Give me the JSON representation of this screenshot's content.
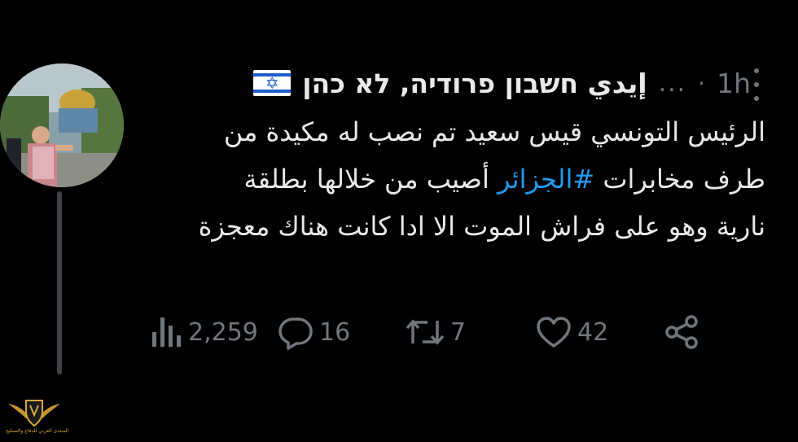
{
  "tweet": {
    "display_name": "إيدي חשבון פרודיה, לא כהן",
    "name_ellipsis": "...",
    "separator": "·",
    "timestamp": "1h",
    "text_before_hashtag": "الرئيس التونسي قيس سعيد تم نصب له مكيدة من طرف مخابرات ",
    "hashtag": "#الجزائر",
    "text_after_hashtag": " أصيب من خلالها بطلقة نارية وهو على فراش الموت الا ادا كانت هناك معجزة",
    "flag_icon": "israel-flag-icon"
  },
  "actions": {
    "views": "2,259",
    "replies": "16",
    "retweets": "7",
    "likes": "42"
  },
  "colors": {
    "background": "#000000",
    "text": "#e7e9ea",
    "muted": "#71767b",
    "link": "#1d9bf0"
  },
  "watermark": {
    "caption": "المنتدى العربي للدفاع والتسليح"
  }
}
